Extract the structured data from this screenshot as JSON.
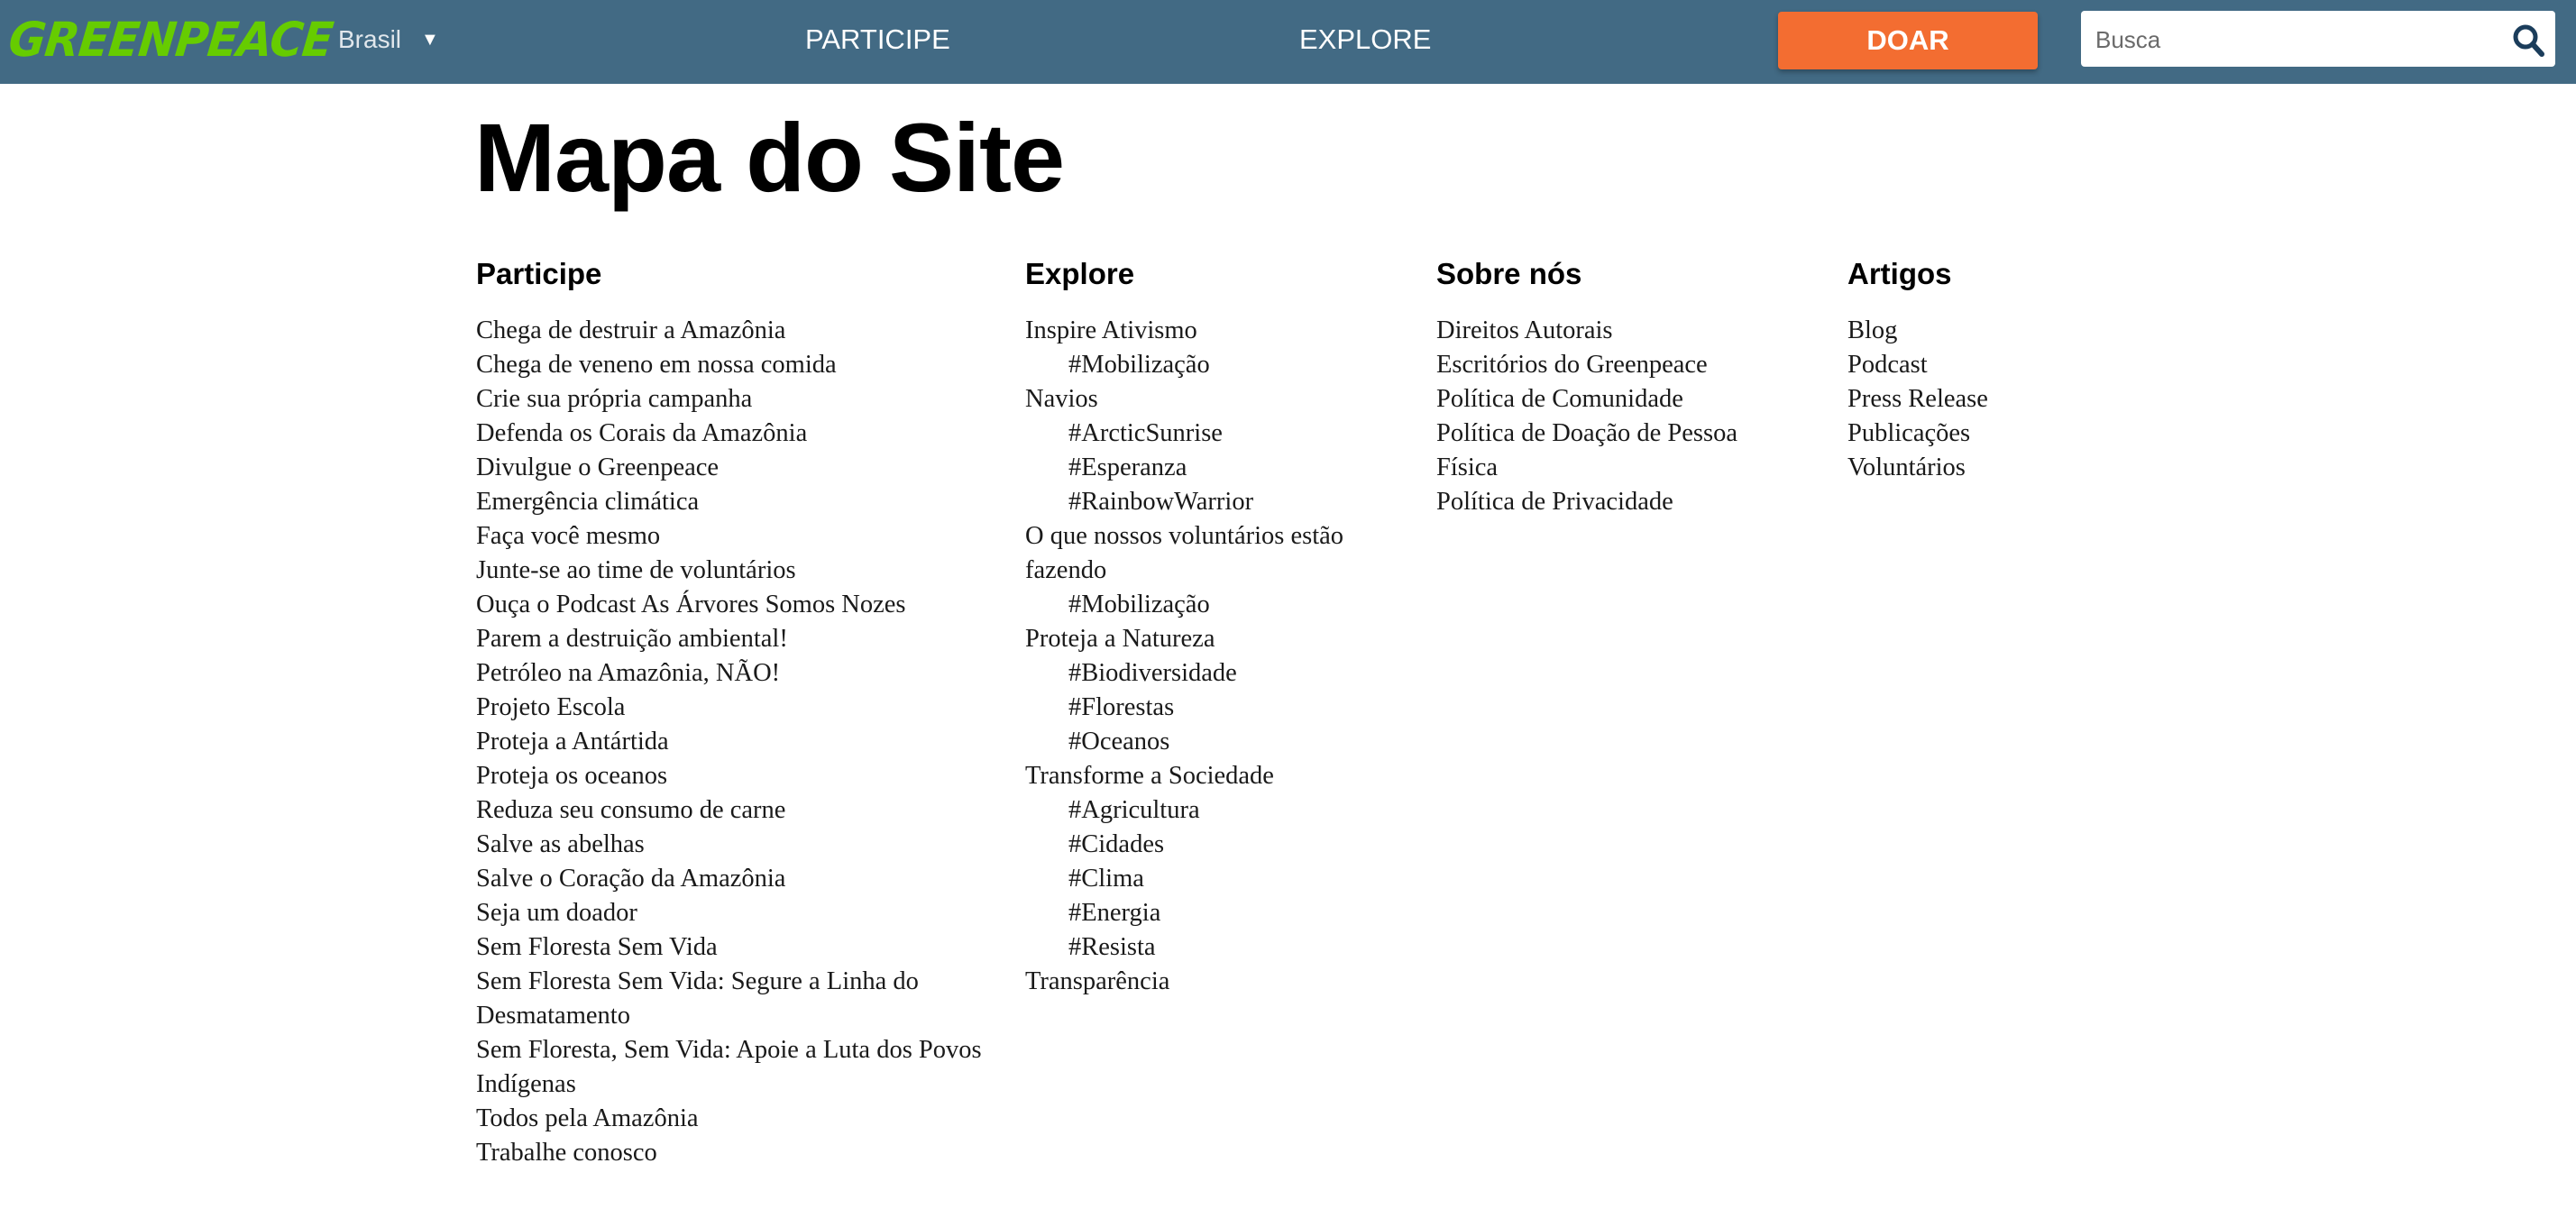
{
  "header": {
    "logo": "GREENPEACE",
    "country": "Brasil",
    "country_arrow": "▼",
    "nav": [
      "PARTICIPE",
      "EXPLORE"
    ],
    "donate_label": "DOAR",
    "search_placeholder": "Busca",
    "colors": {
      "bar": "#426a84",
      "logo": "#66cc00",
      "donate": "#f36d31",
      "search_icon": "#1b3d5b"
    }
  },
  "page_title": "Mapa do Site",
  "columns": [
    {
      "heading": "Participe",
      "items": [
        {
          "label": "Chega de destruir a Amazônia",
          "sub": false
        },
        {
          "label": "Chega de veneno em nossa comida",
          "sub": false
        },
        {
          "label": "Crie sua própria campanha",
          "sub": false
        },
        {
          "label": "Defenda os Corais da Amazônia",
          "sub": false
        },
        {
          "label": "Divulgue o Greenpeace",
          "sub": false
        },
        {
          "label": "Emergência climática",
          "sub": false
        },
        {
          "label": "Faça você mesmo",
          "sub": false
        },
        {
          "label": "Junte-se ao time de voluntários",
          "sub": false
        },
        {
          "label": "Ouça o Podcast As Árvores Somos Nozes",
          "sub": false
        },
        {
          "label": "Parem a destruição ambiental!",
          "sub": false
        },
        {
          "label": "Petróleo na Amazônia, NÃO!",
          "sub": false
        },
        {
          "label": "Projeto Escola",
          "sub": false
        },
        {
          "label": "Proteja a Antártida",
          "sub": false
        },
        {
          "label": "Proteja os oceanos",
          "sub": false
        },
        {
          "label": "Reduza seu consumo de carne",
          "sub": false
        },
        {
          "label": "Salve as abelhas",
          "sub": false
        },
        {
          "label": "Salve o Coração da Amazônia",
          "sub": false
        },
        {
          "label": "Seja um doador",
          "sub": false
        },
        {
          "label": "Sem Floresta Sem Vida",
          "sub": false
        },
        {
          "label": "Sem Floresta Sem Vida: Segure a Linha do Desmatamento",
          "sub": false
        },
        {
          "label": "Sem Floresta, Sem Vida: Apoie a Luta dos Povos Indígenas",
          "sub": false
        },
        {
          "label": "Todos pela Amazônia",
          "sub": false
        },
        {
          "label": "Trabalhe conosco",
          "sub": false
        }
      ]
    },
    {
      "heading": "Explore",
      "items": [
        {
          "label": "Inspire Ativismo",
          "sub": false
        },
        {
          "label": "#Mobilização",
          "sub": true
        },
        {
          "label": "Navios",
          "sub": false
        },
        {
          "label": "#ArcticSunrise",
          "sub": true
        },
        {
          "label": "#Esperanza",
          "sub": true
        },
        {
          "label": "#RainbowWarrior",
          "sub": true
        },
        {
          "label": "O que nossos voluntários estão fazendo",
          "sub": false
        },
        {
          "label": "#Mobilização",
          "sub": true
        },
        {
          "label": "Proteja a Natureza",
          "sub": false
        },
        {
          "label": "#Biodiversidade",
          "sub": true
        },
        {
          "label": "#Florestas",
          "sub": true
        },
        {
          "label": "#Oceanos",
          "sub": true
        },
        {
          "label": "Transforme a Sociedade",
          "sub": false
        },
        {
          "label": "#Agricultura",
          "sub": true
        },
        {
          "label": "#Cidades",
          "sub": true
        },
        {
          "label": "#Clima",
          "sub": true
        },
        {
          "label": "#Energia",
          "sub": true
        },
        {
          "label": "#Resista",
          "sub": true
        },
        {
          "label": "Transparência",
          "sub": false
        }
      ]
    },
    {
      "heading": "Sobre nós",
      "items": [
        {
          "label": "Direitos Autorais",
          "sub": false
        },
        {
          "label": "Escritórios do Greenpeace",
          "sub": false
        },
        {
          "label": "Política de Comunidade",
          "sub": false
        },
        {
          "label": "Política de Doação de Pessoa Física",
          "sub": false
        },
        {
          "label": "Política de Privacidade",
          "sub": false
        }
      ]
    },
    {
      "heading": "Artigos",
      "items": [
        {
          "label": "Blog",
          "sub": false
        },
        {
          "label": "Podcast",
          "sub": false
        },
        {
          "label": "Press Release",
          "sub": false
        },
        {
          "label": "Publicações",
          "sub": false
        },
        {
          "label": "Voluntários",
          "sub": false
        }
      ]
    }
  ]
}
